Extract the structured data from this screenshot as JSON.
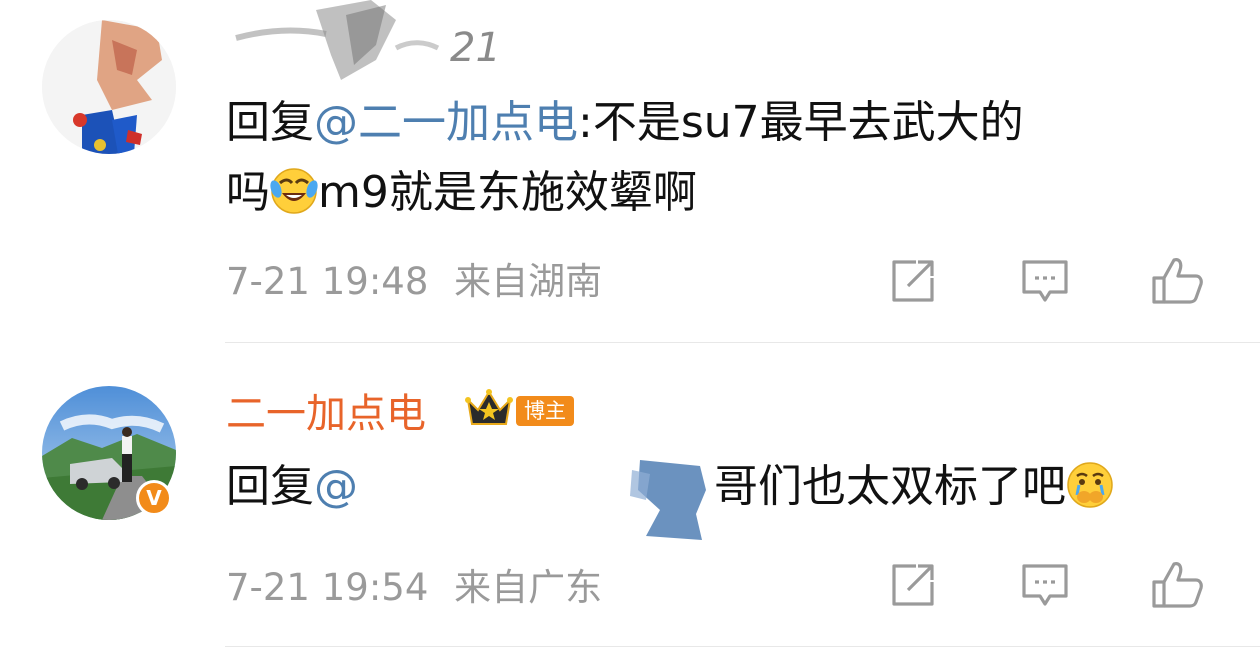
{
  "comments": [
    {
      "username": "21",
      "reply_prefix": "回复",
      "mention": "@二一加点电",
      "text_line1": ":不是su7最早去武大的",
      "text_line2_a": "吗",
      "emoji_a": "laughing-tears-emoji",
      "text_line2_b": "m9就是东施效颦啊",
      "timestamp": "7-21 19:48",
      "location": "来自湖南"
    },
    {
      "username": "二一加点电",
      "badge_label": "博主",
      "reply_prefix": "回复",
      "mention": "@",
      "text_rest": "哥们也太双标了吧",
      "emoji_b": "crying-covering-mouth-emoji",
      "timestamp": "7-21 19:54",
      "location": "来自广东"
    }
  ],
  "colors": {
    "mention": "#4e7fb0",
    "blogger_name": "#e8642a",
    "meta_text": "#9a9a9a",
    "badge": "#f28b1a"
  },
  "icons": [
    "share-icon",
    "comment-icon",
    "like-icon",
    "crown-icon",
    "verified-icon"
  ]
}
